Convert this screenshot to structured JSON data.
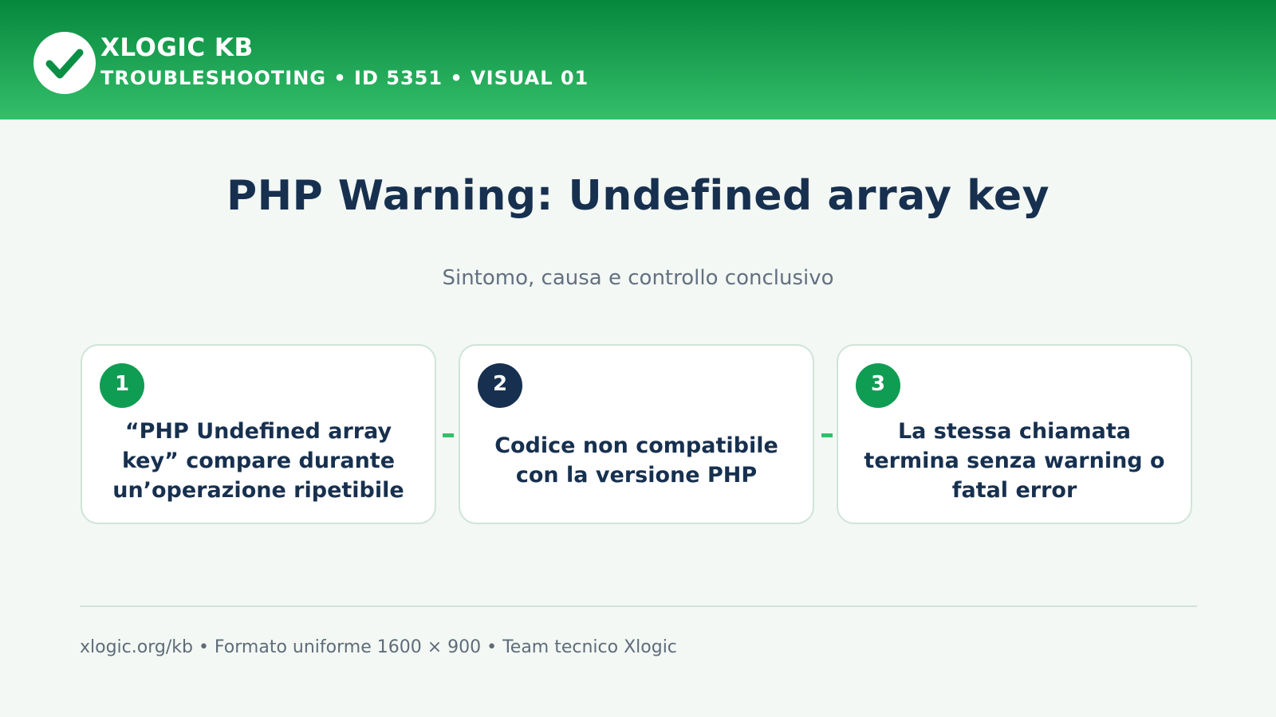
{
  "header": {
    "brand": "XLOGIC KB",
    "subtitle": "TROUBLESHOOTING • ID 5351 • VISUAL 01",
    "logo_icon": "check-icon"
  },
  "main": {
    "title": "PHP Warning: Undefined array key",
    "subtitle": "Sintomo, causa e controllo conclusivo"
  },
  "steps": [
    {
      "number": "1",
      "text": "“PHP Undefined array key” compare durante un’operazione ripetibile",
      "badge_color": "#0f9d53"
    },
    {
      "number": "2",
      "text": "Codice non compatibile con la versione PHP",
      "badge_color": "#17304f"
    },
    {
      "number": "3",
      "text": "La stessa chiamata termina senza warning o fatal error",
      "badge_color": "#0f9d53"
    }
  ],
  "footer": {
    "text": "xlogic.org/kb • Formato uniforme 1600 × 900 • Team tecnico Xlogic"
  },
  "colors": {
    "brand_green": "#06873d",
    "brand_green_light": "#34bf6a",
    "navy": "#17304f",
    "background": "#f3f8f5"
  }
}
